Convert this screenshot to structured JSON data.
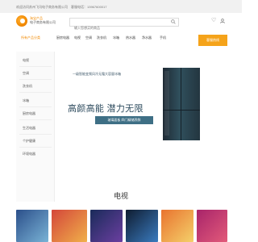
{
  "topbar": {
    "company": "欢迎访问苏州飞讯电子商务有限公司",
    "hotline_label": "客服电话：",
    "hotline_number": "13967600017"
  },
  "header": {
    "logo_line1": "淘宝产品",
    "logo_line2": "电子商务有限公司",
    "search_placeholder": "输入您想买的商品"
  },
  "nav": {
    "category_toggle": "所有产品分类",
    "items": [
      "厨房电器",
      "电视",
      "空调",
      "洗衣机",
      "冰箱",
      "热水器",
      "净水器",
      "手机"
    ],
    "cta": "客服热线"
  },
  "sidebar": {
    "items": [
      "电视",
      "空调",
      "洗衣机",
      "冰箱",
      "厨房电器",
      "生活电器",
      "个护健康",
      "环境电器"
    ]
  },
  "banner": {
    "tagline_small": "一级智能变频风冷无霜大容量冰箱",
    "tagline_big": "高颜高能 潜力无限",
    "pill_text": "玻璃面板 四门精储养鲜"
  },
  "section": {
    "title": "电视"
  },
  "colors": {
    "accent": "#f28a00",
    "cta": "#f5a31a",
    "banner_pill": "#3e6f85",
    "tagline": "#2c4a5d"
  },
  "icons": {
    "search": "search-icon",
    "favorite": "heart-icon",
    "user": "user-icon"
  }
}
